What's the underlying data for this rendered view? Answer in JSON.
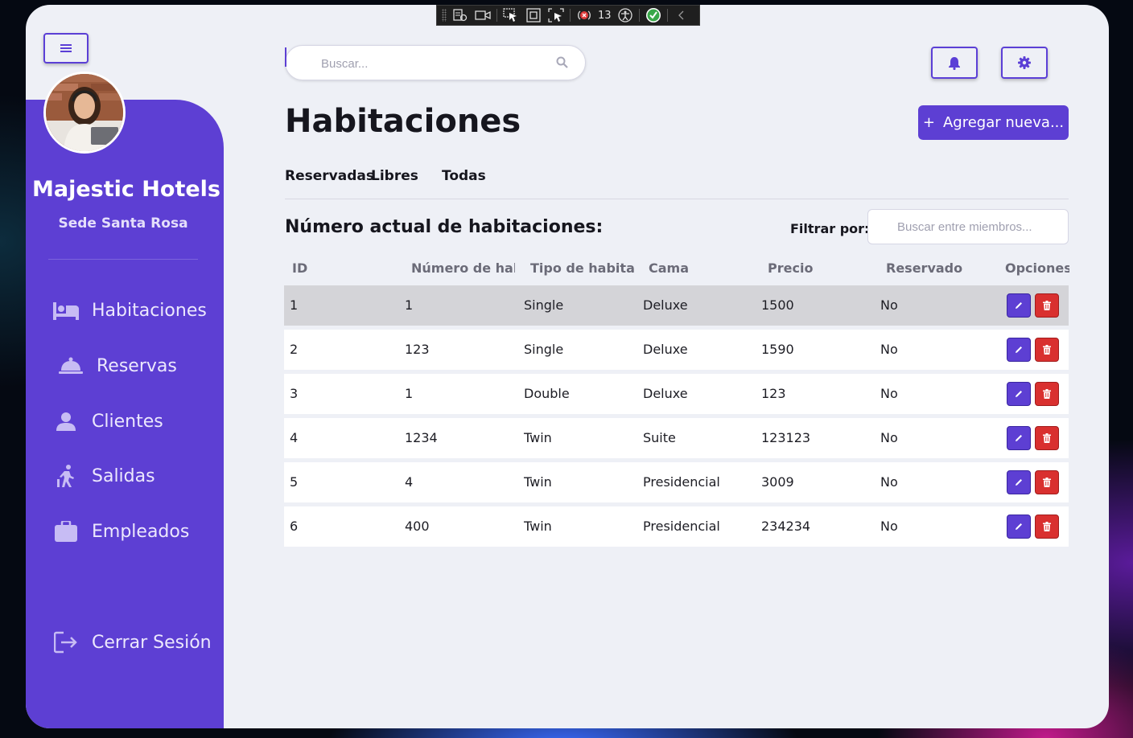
{
  "debug_toolbar": {
    "counter": "13",
    "icons": [
      "live-visual-tree-icon",
      "record-icon",
      "select-element-icon",
      "display-layout-adorners-icon",
      "track-focus-icon",
      "binding-failures-icon",
      "accessibility-icon",
      "hot-reload-ok-icon",
      "collapse-icon"
    ]
  },
  "sidebar": {
    "hotel_name": "Majestic Hotels",
    "hotel_branch": "Sede Santa Rosa",
    "items": [
      {
        "label": "Habitaciones",
        "icon": "bed-icon"
      },
      {
        "label": "Reservas",
        "icon": "service-bell-icon"
      },
      {
        "label": "Clientes",
        "icon": "user-icon"
      },
      {
        "label": "Salidas",
        "icon": "walking-person-icon"
      },
      {
        "label": "Empleados",
        "icon": "briefcase-icon"
      }
    ],
    "logout_label": "Cerrar Sesión"
  },
  "header": {
    "search_placeholder": "Buscar...",
    "page_title": "Habitaciones",
    "add_button_label": "Agregar nueva..."
  },
  "tabs": [
    "Reservadas",
    "Libres",
    "Todas"
  ],
  "toolbar": {
    "count_label": "Número actual de habitaciones:",
    "filter_label": "Filtrar por:",
    "filter_placeholder": "Buscar entre miembros..."
  },
  "table": {
    "columns": [
      "ID",
      "Número de habitación",
      "Tipo de habitación",
      "Cama",
      "Precio",
      "Reservado",
      "Opciones"
    ],
    "columns_display": [
      "ID",
      "Número de habit",
      "Tipo de habitació",
      "Cama",
      "Precio",
      "Reservado",
      "Opciones"
    ],
    "rows": [
      {
        "id": "1",
        "numero": "1",
        "tipo": "Single",
        "cama": "Deluxe",
        "precio": "1500",
        "reservado": "No"
      },
      {
        "id": "2",
        "numero": "123",
        "tipo": "Single",
        "cama": "Deluxe",
        "precio": "1590",
        "reservado": "No"
      },
      {
        "id": "3",
        "numero": "1",
        "tipo": "Double",
        "cama": "Deluxe",
        "precio": "123",
        "reservado": "No"
      },
      {
        "id": "4",
        "numero": "1234",
        "tipo": "Twin",
        "cama": "Suite",
        "precio": "123123",
        "reservado": "No"
      },
      {
        "id": "5",
        "numero": "4",
        "tipo": "Twin",
        "cama": "Presidencial",
        "precio": "3009",
        "reservado": "No"
      },
      {
        "id": "6",
        "numero": "400",
        "tipo": "Twin",
        "cama": "Presidencial",
        "precio": "234234",
        "reservado": "No"
      }
    ],
    "selected_row": "1"
  },
  "colors": {
    "accent": "#5d3fd3",
    "delete": "#d9302f",
    "background": "#eef0f6",
    "selected_row": "#d4d4d8"
  }
}
